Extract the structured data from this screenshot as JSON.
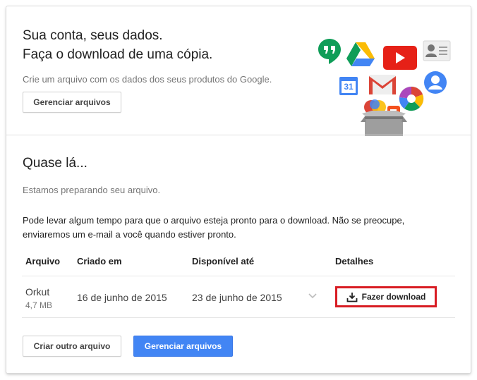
{
  "header": {
    "title_line1": "Sua conta, seus dados.",
    "title_line2": "Faça o download de uma cópia.",
    "subtitle": "Crie um arquivo com os dados dos seus produtos do Google.",
    "manage_button": "Gerenciar arquivos",
    "calendar_day": "31"
  },
  "main": {
    "heading": "Quase lá...",
    "status": "Estamos preparando seu arquivo.",
    "note": "Pode levar algum tempo para que o arquivo esteja pronto para o download. Não se preocupe, enviaremos um e-mail a você quando estiver pronto.",
    "table": {
      "columns": [
        "Arquivo",
        "Criado em",
        "Disponível até",
        "Detalhes"
      ],
      "rows": [
        {
          "name": "Orkut",
          "size": "4,7 MB",
          "created": "16 de junho de 2015",
          "available_until": "23 de junho de 2015",
          "action": "Fazer download"
        }
      ]
    },
    "create_button": "Criar outro arquivo",
    "manage_button": "Gerenciar arquivos"
  },
  "colors": {
    "accent_blue": "#4285f4",
    "highlight_red": "#d81c23"
  },
  "icons": [
    "hangouts-icon",
    "drive-icon",
    "youtube-icon",
    "contacts-icon",
    "calendar-icon",
    "gmail-icon",
    "picasa-icon",
    "profile-icon",
    "google-plus-icon",
    "blogger-icon",
    "archive-box-icon",
    "download-icon",
    "chevron-down-icon"
  ]
}
